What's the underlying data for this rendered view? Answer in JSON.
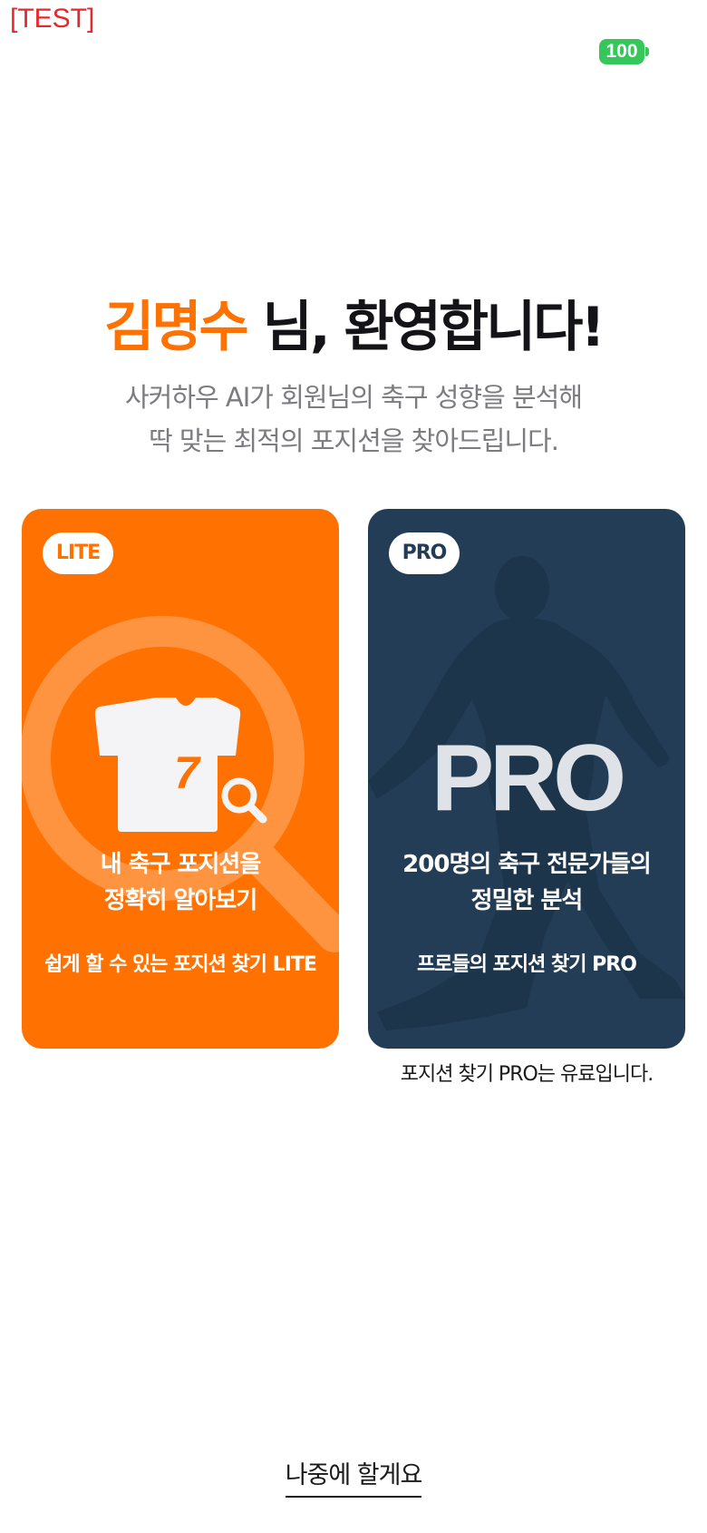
{
  "env_label": "[TEST]",
  "status": {
    "battery": "100"
  },
  "welcome": {
    "name": "김명수",
    "title_suffix": " 님, 환영합니다!",
    "subtitle_line1": "사커하우 AI가 회원님의 축구 성향을 분석해",
    "subtitle_line2": "딱 맞는 최적의 포지션을 찾아드립니다."
  },
  "lite_card": {
    "badge": "LITE",
    "jersey_number": "7",
    "headline_line1": "내 축구 포지션을",
    "headline_line2": "정확히 알아보기",
    "subtitle": "쉽게 할 수 있는 포지션 찾기 LITE",
    "color": "#ff7100"
  },
  "pro_card": {
    "badge": "PRO",
    "big_label": "PRO",
    "headline_line1": "200명의 축구 전문가들의",
    "headline_line2": "정밀한 분석",
    "subtitle": "프로들의 포지션 찾기 PRO",
    "color": "#223d55"
  },
  "pro_note": "포지션 찾기 PRO는 유료입니다.",
  "later_link": "나중에 할게요"
}
